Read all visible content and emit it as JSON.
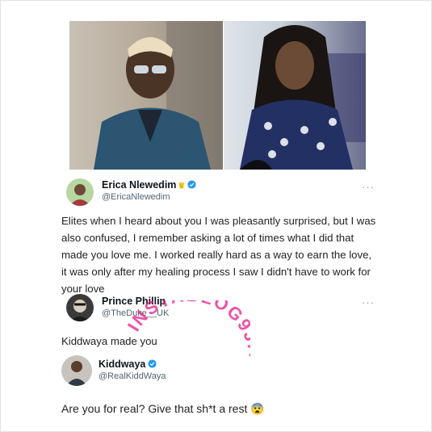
{
  "tweets": [
    {
      "display_name": "Erica Nlewedim",
      "handle": "@EricaNlewedim",
      "text": "Elites when I heard about you I was pleasantly surprised, but I was also confused, I remember asking a lot of times what I did that made you love me. I worked really hard as a way to earn the love, it was only after my healing process I saw I didn't have to work for your love",
      "more": "···"
    },
    {
      "display_name": "Prince Phillip",
      "handle": "@TheDuke__UK",
      "text": "Kiddwaya made you",
      "more": "···"
    },
    {
      "display_name": "Kiddwaya",
      "handle": "@RealKiddWaya",
      "text": "Are you for real? Give that sh*t a rest 😨",
      "more": ""
    }
  ],
  "watermark": "INSTABLOG9JA",
  "colors": {
    "verified": "#1d9bf0",
    "watermark": "#e8198b"
  }
}
